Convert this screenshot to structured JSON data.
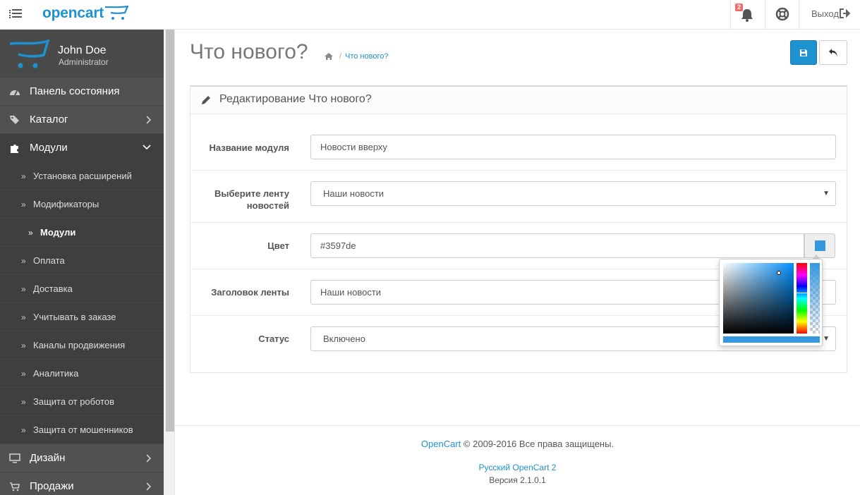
{
  "header": {
    "logo": "opencart",
    "notification_count": "2",
    "logout_label": "Выход"
  },
  "profile": {
    "name": "John Doe",
    "role": "Administrator"
  },
  "sidebar": {
    "items": [
      {
        "label": "Панель состояния",
        "icon": "dashboard-icon"
      },
      {
        "label": "Каталог",
        "icon": "tags-icon"
      },
      {
        "label": "Модули",
        "icon": "puzzle-icon"
      },
      {
        "label": "Дизайн",
        "icon": "monitor-icon"
      },
      {
        "label": "Продажи",
        "icon": "cart-icon"
      }
    ],
    "sub_items": [
      {
        "label": "Установка расширений"
      },
      {
        "label": "Модификаторы"
      },
      {
        "label": "Модули"
      },
      {
        "label": "Оплата"
      },
      {
        "label": "Доставка"
      },
      {
        "label": "Учитывать в заказе"
      },
      {
        "label": "Каналы продвижения"
      },
      {
        "label": "Аналитика"
      },
      {
        "label": "Защита от роботов"
      },
      {
        "label": "Защита от мошенников"
      }
    ]
  },
  "page": {
    "title": "Что нового?",
    "breadcrumb": "Что нового?",
    "panel_title": "Редактирование Что нового?"
  },
  "form": {
    "module_name_label": "Название модуля",
    "module_name_value": "Новости вверху",
    "feed_label": "Выберите ленту новостей",
    "feed_value": "Наши новости",
    "color_label": "Цвет",
    "color_value": "#3597de",
    "feed_title_label": "Заголовок ленты",
    "feed_title_value": "Наши новости",
    "status_label": "Статус",
    "status_value": "Включено"
  },
  "colors": {
    "accent": "#1e91cf",
    "picked": "#3597de",
    "sidebar_bg": "#515151"
  },
  "footer": {
    "brand_link": "OpenCart",
    "copyright": "© 2009-2016 Все права защищены.",
    "russian_link": "Русский OpenCart 2",
    "version": "Версия 2.1.0.1"
  }
}
